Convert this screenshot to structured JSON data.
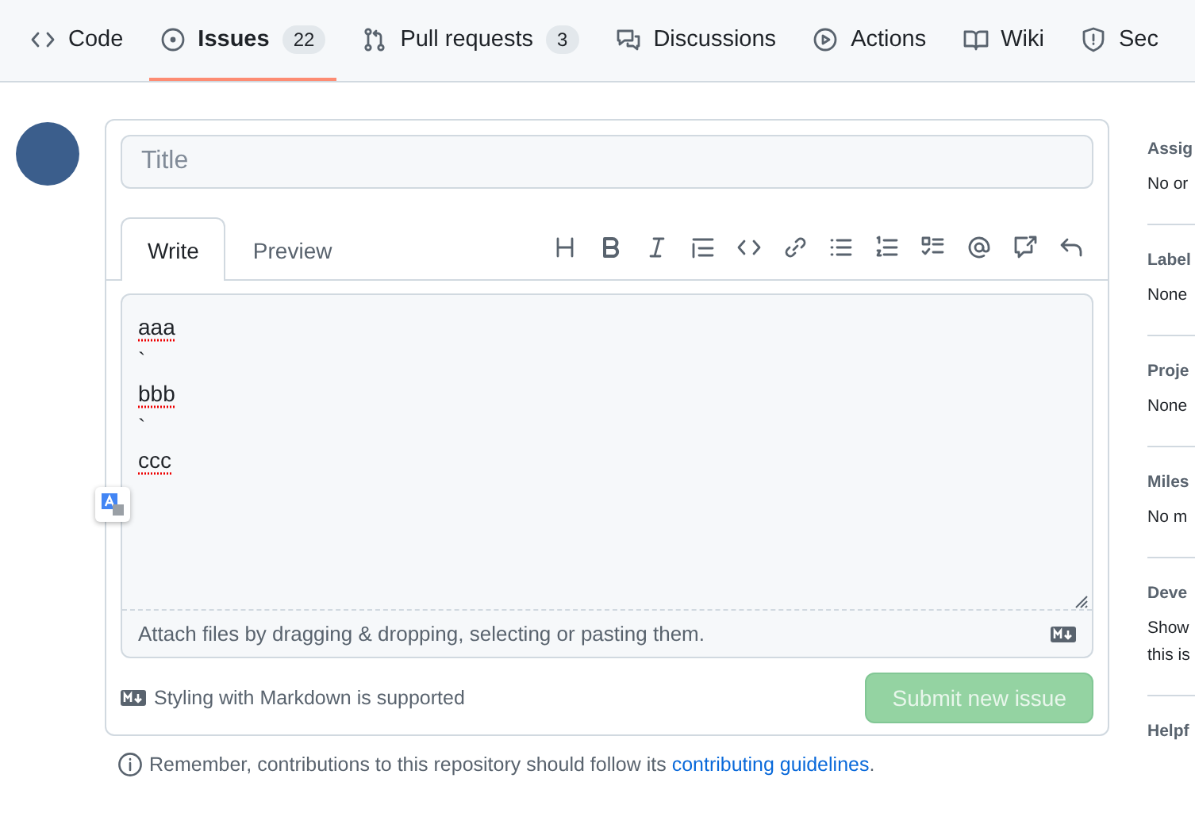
{
  "nav": {
    "tabs": [
      {
        "label": "Code",
        "selected": false
      },
      {
        "label": "Issues",
        "count": "22",
        "selected": true
      },
      {
        "label": "Pull requests",
        "count": "3",
        "selected": false
      },
      {
        "label": "Discussions",
        "selected": false
      },
      {
        "label": "Actions",
        "selected": false
      },
      {
        "label": "Wiki",
        "selected": false
      },
      {
        "label": "Sec",
        "selected": false
      }
    ]
  },
  "form": {
    "title": {
      "placeholder": "Title"
    },
    "tabs": [
      {
        "label": "Write",
        "selected": true
      },
      {
        "label": "Preview",
        "selected": false
      }
    ],
    "body": [
      {
        "text": "aaa",
        "misspelled": true
      },
      {
        "text": "`",
        "misspelled": false
      },
      {
        "text": "bbb",
        "misspelled": true
      },
      {
        "text": "`",
        "misspelled": false
      },
      {
        "text": "ccc",
        "misspelled": true
      }
    ],
    "attach_hint": "Attach files by dragging & dropping, selecting or pasting them.",
    "markdown_note": "Styling with Markdown is supported",
    "submit": {
      "label": "Submit new issue",
      "disabled": true
    }
  },
  "notice": {
    "text": "Remember, contributions to this repository should follow its",
    "link": "contributing guidelines",
    "end": "."
  },
  "sidebar": [
    {
      "heading": "Assig",
      "value": [
        "No or"
      ]
    },
    {
      "heading": "Label",
      "value": [
        "None"
      ]
    },
    {
      "heading": "Proje",
      "value": [
        "None"
      ]
    },
    {
      "heading": "Miles",
      "value": [
        "No m"
      ]
    },
    {
      "heading": "Deve",
      "value": [
        "Show",
        "this is"
      ]
    },
    {
      "heading": "Helpf"
    }
  ]
}
